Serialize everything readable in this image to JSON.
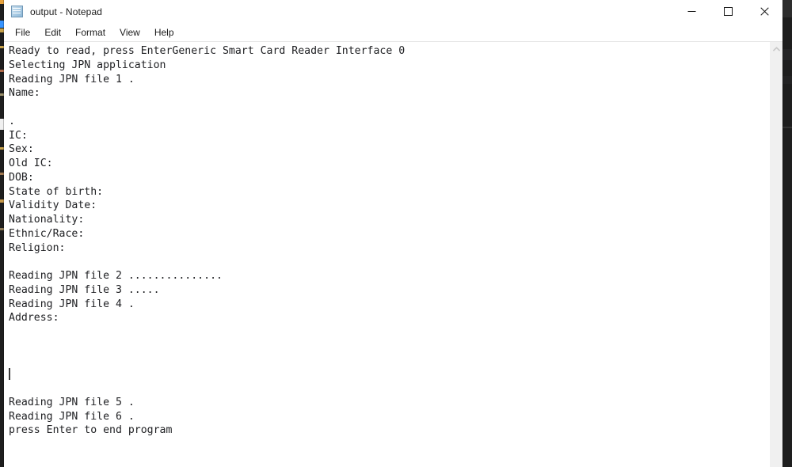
{
  "window": {
    "title": "output - Notepad",
    "app_icon": "notepad-icon"
  },
  "window_controls": {
    "minimize_label": "Minimize",
    "maximize_label": "Maximize",
    "close_label": "Close"
  },
  "menubar": {
    "items": [
      {
        "label": "File"
      },
      {
        "label": "Edit"
      },
      {
        "label": "Format"
      },
      {
        "label": "View"
      },
      {
        "label": "Help"
      }
    ]
  },
  "document": {
    "lines": [
      "Ready to read, press EnterGeneric Smart Card Reader Interface 0",
      "Selecting JPN application",
      "Reading JPN file 1 .",
      "Name:",
      "",
      ".",
      "IC:",
      "Sex:",
      "Old IC:",
      "DOB:",
      "State of birth:",
      "Validity Date:",
      "Nationality:",
      "Ethnic/Race:",
      "Religion:",
      "",
      "Reading JPN file 2 ...............",
      "Reading JPN file 3 .....",
      "Reading JPN file 4 .",
      "Address:",
      "",
      "",
      "",
      "",
      "",
      "Reading JPN file 5 .",
      "Reading JPN file 6 .",
      "press Enter to end program"
    ],
    "caret_line_index": 23
  },
  "scrollbar": {
    "up_arrow": "chevron-up-icon"
  },
  "colors": {
    "window_background": "#ffffff",
    "text": "#202124",
    "desktop_background": "#1e1e1e",
    "scrollbar_track": "#f0f0f0",
    "close_hover": "#e81123"
  }
}
